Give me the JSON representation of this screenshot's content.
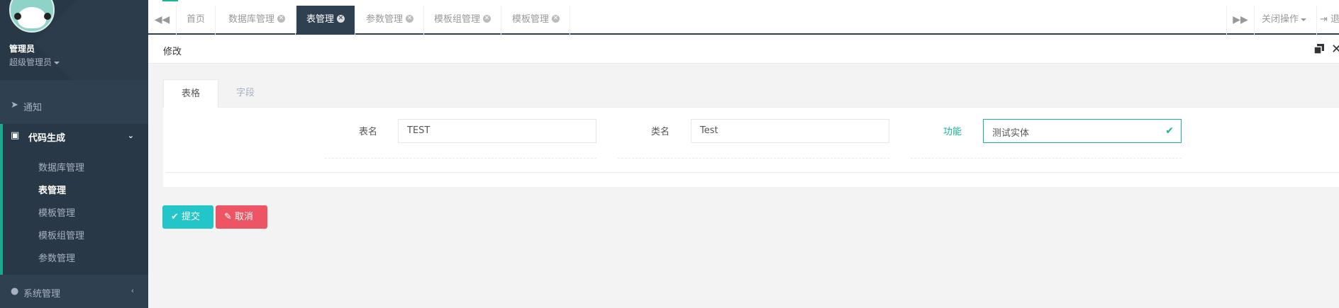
{
  "user": {
    "name": "管理员",
    "role": "超级管理员"
  },
  "sidebar": {
    "notice": "通知",
    "codegen": "代码生成",
    "sub_items": [
      "数据库管理",
      "表管理",
      "模板管理",
      "模板组管理",
      "参数管理"
    ],
    "active_sub": "表管理",
    "system": "系统管理"
  },
  "tabs": {
    "home": "首页",
    "items": [
      "数据库管理",
      "表管理",
      "参数管理",
      "模板组管理",
      "模板管理"
    ],
    "active": "表管理",
    "close_ops": "关闭操作",
    "logout": "退出"
  },
  "panel": {
    "title": "修改"
  },
  "form": {
    "tab_table": "表格",
    "tab_fields": "字段",
    "table_name_label": "表名",
    "table_name_value": "TEST",
    "class_name_label": "类名",
    "class_name_value": "Test",
    "function_label": "功能",
    "function_value": "测试实体"
  },
  "buttons": {
    "submit": "提交",
    "cancel": "取消"
  },
  "colors": {
    "sidebar": "#2f4050",
    "accent": "#1ab394",
    "submit": "#23c6c8",
    "cancel": "#ed5565"
  }
}
